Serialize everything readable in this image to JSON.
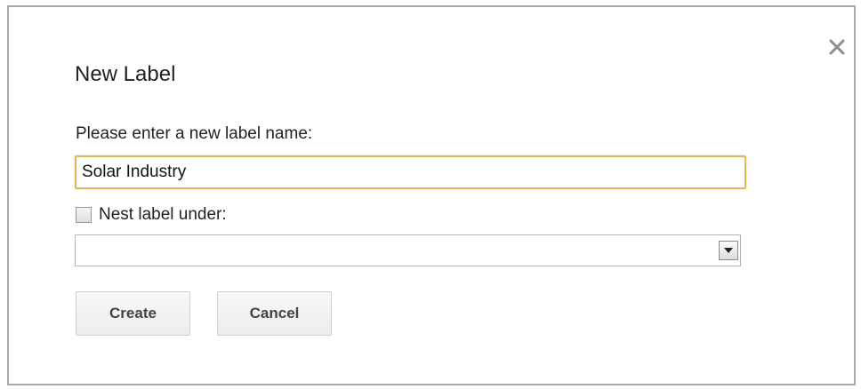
{
  "dialog": {
    "title": "New Label",
    "close_icon": "close-icon"
  },
  "form": {
    "prompt": "Please enter a new label name:",
    "name_value": "Solar Industry",
    "nest_label": "Nest label under:",
    "nest_checked": false,
    "parent_selected": "",
    "dropdown_icon": "chevron-down-icon"
  },
  "buttons": {
    "create_label": "Create",
    "cancel_label": "Cancel"
  },
  "colors": {
    "input_focus_border": "#e0b85a",
    "dialog_border": "#a9a9a9",
    "button_text": "#444444"
  }
}
